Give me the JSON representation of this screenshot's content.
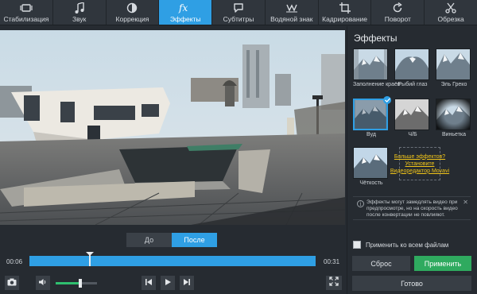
{
  "toolbar": {
    "tabs": [
      {
        "label": "Стабилизация",
        "icon": "stabilization-icon"
      },
      {
        "label": "Звук",
        "icon": "music-note-icon"
      },
      {
        "label": "Коррекция",
        "icon": "contrast-icon"
      },
      {
        "label": "Эффекты",
        "icon": "fx-icon"
      },
      {
        "label": "Субтитры",
        "icon": "speech-bubble-icon"
      },
      {
        "label": "Водяной знак",
        "icon": "watermark-icon"
      },
      {
        "label": "Кадрирование",
        "icon": "crop-icon"
      },
      {
        "label": "Поворот",
        "icon": "rotate-icon"
      },
      {
        "label": "Обрезка",
        "icon": "scissors-icon"
      }
    ],
    "active_tab": "Эффекты"
  },
  "preview": {
    "before_label": "До",
    "after_label": "После",
    "selected_view": "После"
  },
  "timeline": {
    "start_time": "00:06",
    "end_time": "00:31",
    "playhead_fraction": 0.21
  },
  "volume": {
    "level_fraction": 0.6
  },
  "effects_panel": {
    "title": "Эффекты",
    "effects": [
      {
        "label": "Заполнение краёв",
        "selected": false
      },
      {
        "label": "Рыбий глаз",
        "selected": false
      },
      {
        "label": "Эль Греко",
        "selected": false
      },
      {
        "label": "Вуд",
        "selected": true
      },
      {
        "label": "Ч/Б",
        "selected": false
      },
      {
        "label": "Виньетка",
        "selected": false
      },
      {
        "label": "Чёткость",
        "selected": false
      }
    ],
    "more_effects_link": "Больше эффектов?",
    "install_link_1": "Установите",
    "install_link_2": "Видеоредактор Movavi",
    "info_text": "Эффекты могут замедлять видео при предпросмотре, но на скорость видео после конвертации не повлияют.",
    "apply_all_label": "Применить ко всем файлам",
    "apply_all_checked": false,
    "reset_label": "Сброс",
    "apply_label": "Применить",
    "done_label": "Готово"
  },
  "colors": {
    "accent": "#2f9fe4",
    "apply_green": "#2faa5f",
    "link_yellow": "#f0c419",
    "background": "#262b31"
  }
}
